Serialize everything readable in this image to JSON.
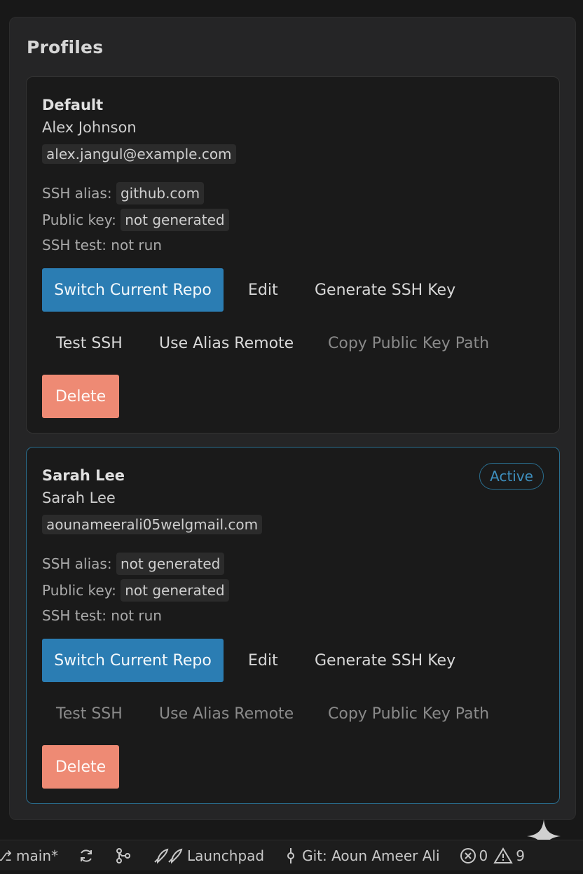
{
  "panel": {
    "title": "Profiles"
  },
  "profiles": [
    {
      "name": "Default",
      "user": "Alex Johnson",
      "email": "alex.jangul@example.com",
      "ssh_alias_label": "SSH alias:",
      "ssh_alias": "github.com",
      "public_key_label": "Public key:",
      "public_key": "not generated",
      "ssh_test": "SSH test: not run",
      "buttons": {
        "switch": "Switch Current Repo",
        "edit": "Edit",
        "generate": "Generate SSH Key",
        "test": "Test SSH",
        "alias_remote": "Use Alias Remote",
        "copy_path": "Copy Public Key Path",
        "delete": "Delete"
      }
    },
    {
      "name": "Sarah Lee",
      "user": "Sarah Lee",
      "email": "aounameerali05welgmail.com",
      "badge": "Active",
      "ssh_alias_label": "SSH alias:",
      "ssh_alias": "not generated",
      "public_key_label": "Public key:",
      "public_key": "not generated",
      "ssh_test": "SSH test: not run",
      "buttons": {
        "switch": "Switch Current Repo",
        "edit": "Edit",
        "generate": "Generate SSH Key",
        "test": "Test SSH",
        "alias_remote": "Use Alias Remote",
        "copy_path": "Copy Public Key Path",
        "delete": "Delete"
      }
    }
  ],
  "statusbar": {
    "branch": "main*",
    "launchpad": "Launchpad",
    "git_user": "Git: Aoun Ameer Ali",
    "errors": "0",
    "warnings": "9"
  },
  "icons": {
    "branch": "git-branch-icon",
    "sync": "sync-icon",
    "launchpad": "rocket-icon",
    "commit": "git-commit-icon",
    "errors": "error-icon",
    "warnings": "warning-icon",
    "sparkle": "sparkle-icon"
  },
  "colors": {
    "primary": "#2b7db3",
    "danger": "#ee8a74",
    "active_border": "#2a6e8f"
  }
}
